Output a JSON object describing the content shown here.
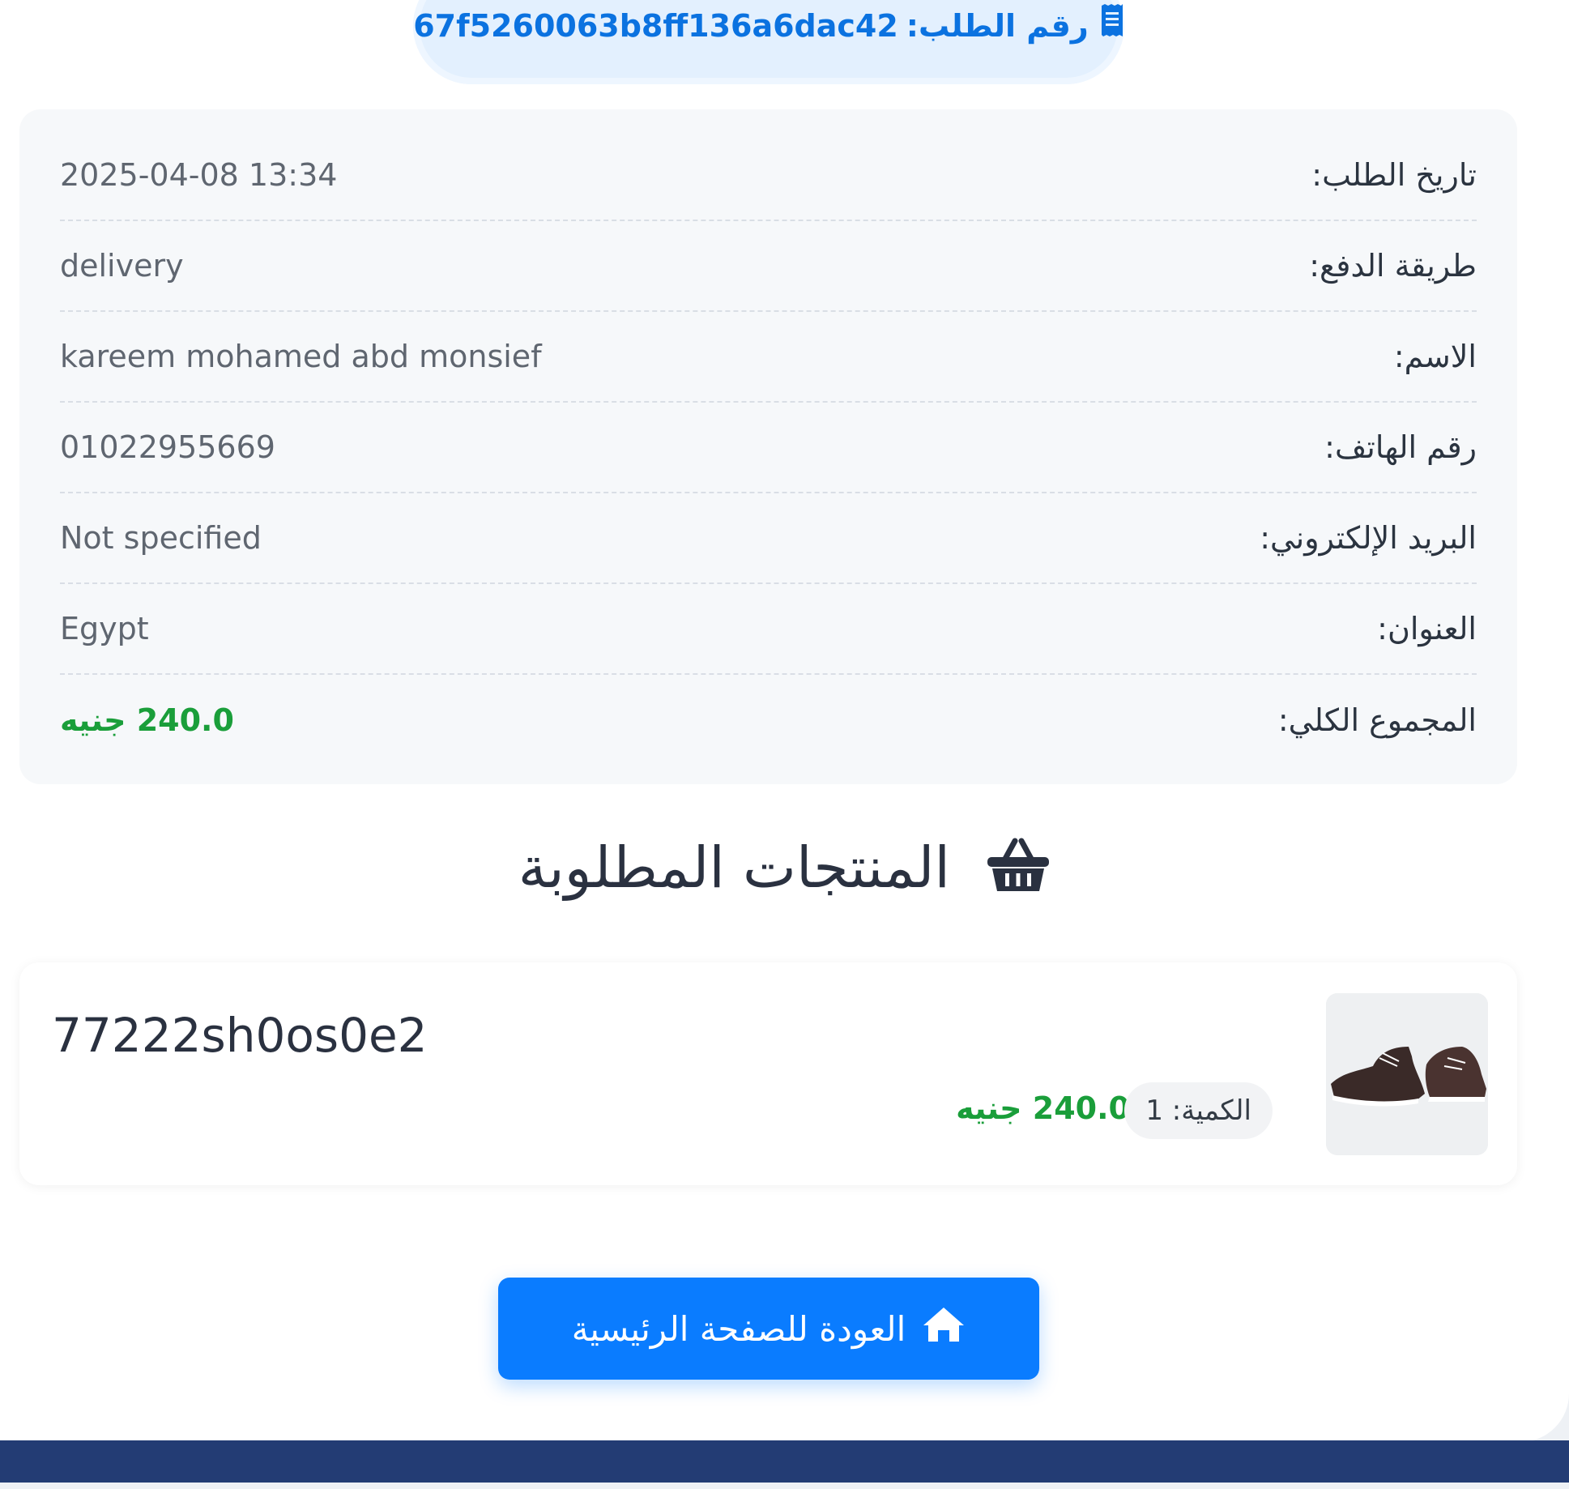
{
  "order": {
    "label": "رقم الطلب:",
    "id": "67f5260063b8ff136a6dac42"
  },
  "details": [
    {
      "label": "تاريخ الطلب:",
      "value": "2025-04-08 13:34"
    },
    {
      "label": "طريقة الدفع:",
      "value": "delivery"
    },
    {
      "label": "الاسم:",
      "value": "kareem mohamed abd monsief"
    },
    {
      "label": "رقم الهاتف:",
      "value": "01022955669"
    },
    {
      "label": "البريد الإلكتروني:",
      "value": "Not specified"
    },
    {
      "label": "العنوان:",
      "value": "Egypt"
    },
    {
      "label": "المجموع الكلي:",
      "value": "240.0 جنيه"
    }
  ],
  "products": {
    "title": "المنتجات المطلوبة",
    "items": [
      {
        "name": "77222sh0os0e2",
        "quantity": "الكمية: 1",
        "price": "240.0 جنيه"
      }
    ]
  },
  "actions": {
    "home_label": "العودة للصفحة الرئيسية"
  },
  "colors": {
    "accent": "#0a7cff",
    "price": "#1a9e3a",
    "footer": "#233c74"
  },
  "icons": {
    "order": "receipt-icon",
    "products": "basket-icon",
    "home": "home-icon"
  }
}
